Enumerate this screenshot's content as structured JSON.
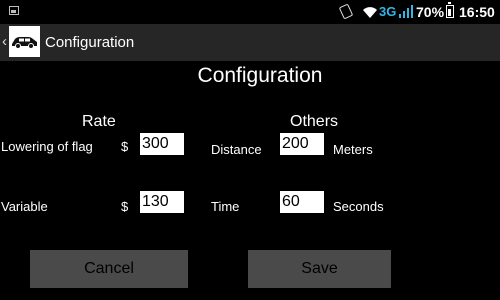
{
  "status_bar": {
    "network": "3G",
    "battery": "70%",
    "time": "16:50",
    "accent_color": "#33b5e5"
  },
  "action_bar": {
    "title": "Configuration",
    "icon": "car-icon"
  },
  "page": {
    "title": "Configuration"
  },
  "rate": {
    "heading": "Rate",
    "lowering_of_flag": {
      "label": "Lowering of flag",
      "currency": "$",
      "value": "300"
    },
    "variable": {
      "label": "Variable",
      "currency": "$",
      "value": "130"
    }
  },
  "others": {
    "heading": "Others",
    "distance": {
      "label": "Distance",
      "value": "200",
      "unit": "Meters"
    },
    "time": {
      "label": "Time",
      "value": "60",
      "unit": "Seconds"
    }
  },
  "buttons": {
    "cancel": "Cancel",
    "save": "Save"
  }
}
